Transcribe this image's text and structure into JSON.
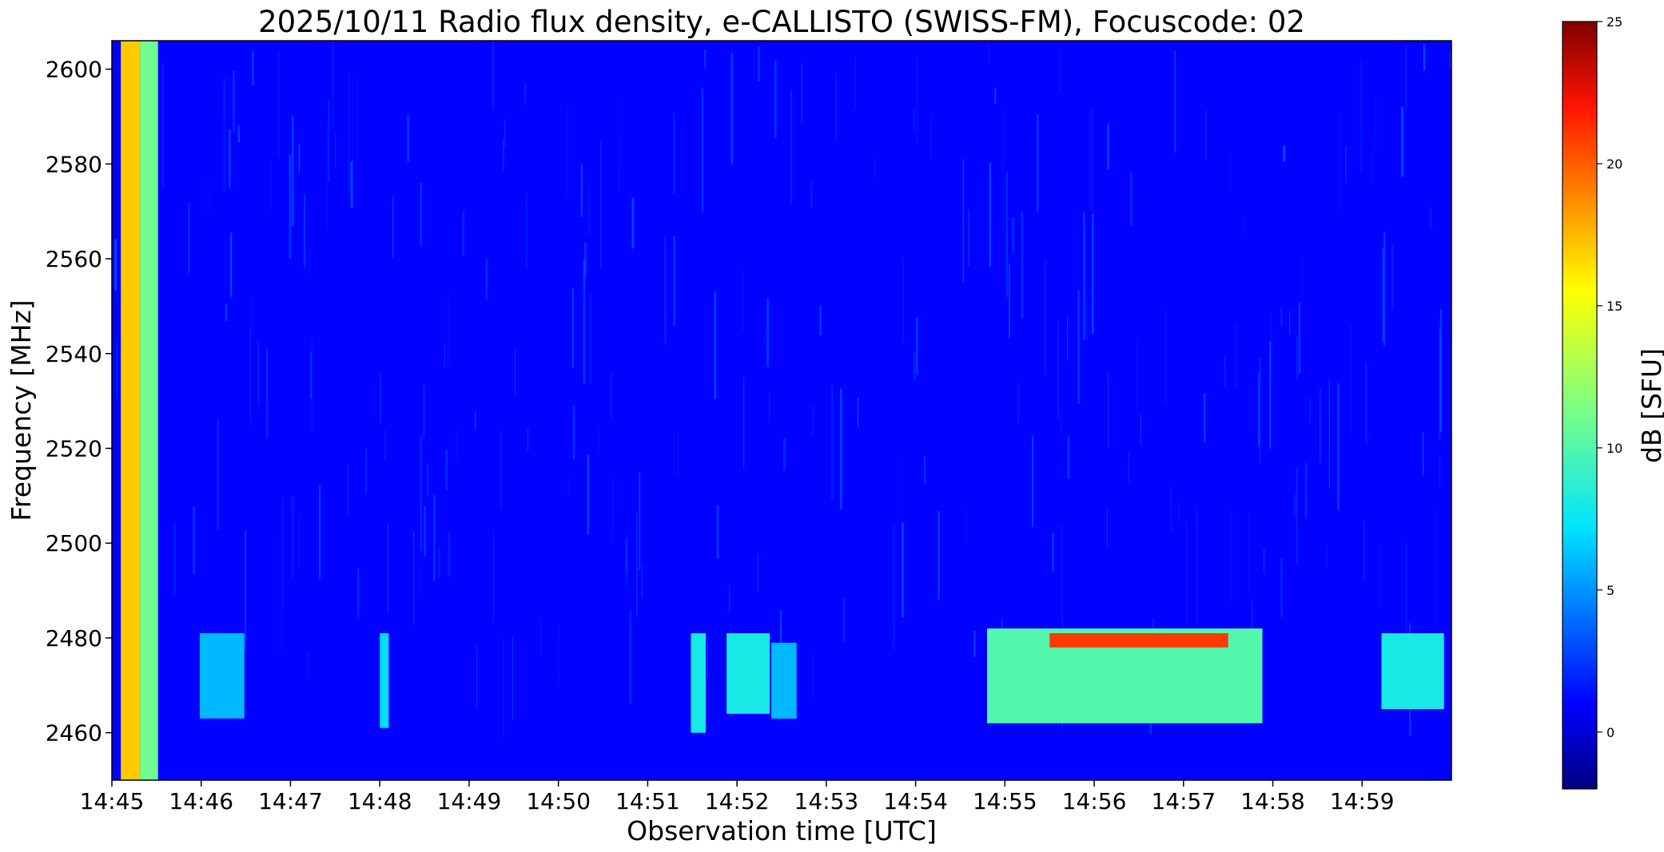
{
  "chart_data": {
    "type": "heatmap",
    "title": "2025/10/11  Radio flux density, e-CALLISTO (SWISS-FM), Focuscode: 02",
    "xlabel": "Observation time [UTC]",
    "ylabel": "Frequency [MHz]",
    "xlim": [
      "14:45",
      "15:00"
    ],
    "ylim": [
      2450,
      2606
    ],
    "x_ticks": [
      "14:45",
      "14:46",
      "14:47",
      "14:48",
      "14:49",
      "14:50",
      "14:51",
      "14:52",
      "14:53",
      "14:54",
      "14:55",
      "14:56",
      "14:57",
      "14:58",
      "14:59"
    ],
    "y_ticks": [
      2460,
      2480,
      2500,
      2520,
      2540,
      2560,
      2580,
      2600
    ],
    "colorbar": {
      "label": "dB [SFU]",
      "range": [
        -2,
        25
      ],
      "ticks": [
        0,
        5,
        10,
        15,
        20,
        25
      ],
      "colormap": "jet"
    },
    "background_level": 1,
    "features": [
      {
        "name": "calibration-band-hot",
        "t_start": "14:45:06",
        "t_end": "14:45:19",
        "f_start": 2450,
        "f_end": 2606,
        "level": 17
      },
      {
        "name": "calibration-band-warm",
        "t_start": "14:45:19",
        "t_end": "14:45:31",
        "f_start": 2450,
        "f_end": 2606,
        "level": 11
      },
      {
        "name": "burst-1",
        "t_start": "14:45:59",
        "t_end": "14:46:29",
        "f_start": 2463,
        "f_end": 2481,
        "level": 6
      },
      {
        "name": "burst-2",
        "t_start": "14:48:00",
        "t_end": "14:48:06",
        "f_start": 2461,
        "f_end": 2481,
        "level": 7
      },
      {
        "name": "burst-3",
        "t_start": "14:51:29",
        "t_end": "14:51:39",
        "f_start": 2460,
        "f_end": 2481,
        "level": 8
      },
      {
        "name": "burst-4",
        "t_start": "14:51:53",
        "t_end": "14:52:22",
        "f_start": 2464,
        "f_end": 2481,
        "level": 8
      },
      {
        "name": "burst-5",
        "t_start": "14:52:23",
        "t_end": "14:52:40",
        "f_start": 2463,
        "f_end": 2479,
        "level": 6
      },
      {
        "name": "burst-main",
        "t_start": "14:54:48",
        "t_end": "14:57:53",
        "f_start": 2462,
        "f_end": 2482,
        "level": 10
      },
      {
        "name": "burst-main-edge",
        "t_start": "14:55:30",
        "t_end": "14:57:30",
        "f_start": 2478,
        "f_end": 2481,
        "level": 21
      },
      {
        "name": "burst-6",
        "t_start": "14:59:13",
        "t_end": "14:59:55",
        "f_start": 2465,
        "f_end": 2481,
        "level": 8
      }
    ]
  }
}
